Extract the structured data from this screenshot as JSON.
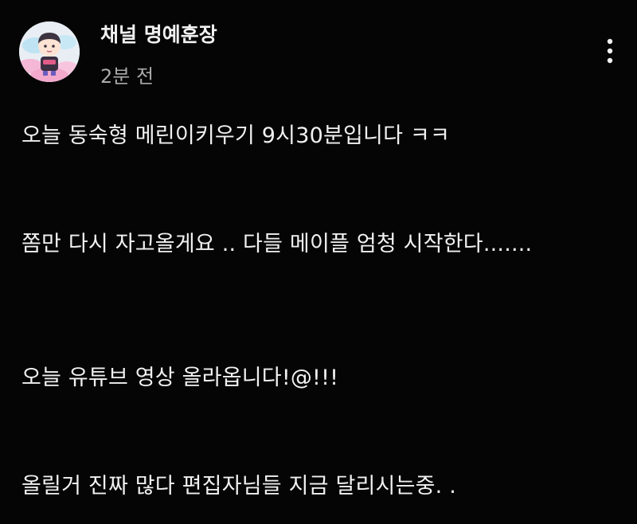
{
  "post": {
    "channel_name": "채널 명예훈장",
    "timestamp": "2분 전",
    "lines": [
      "오늘 동숙형 메린이키우기 9시30분입니다 ㅋㅋ",
      "쫌만 다시 자고올게요 .. 다들 메이플 엄청 시작한다.......",
      "오늘 유튜브 영상 올라옵니다!@!!!",
      "올릴거 진짜 많다 편집자님들 지금 달리시는중. ."
    ]
  },
  "icons": {
    "avatar": "chibi-character-avatar",
    "more": "more-vertical-icon"
  },
  "colors": {
    "background": "#050505",
    "text_primary": "#f1f1f1",
    "text_secondary": "#aaaaaa"
  }
}
